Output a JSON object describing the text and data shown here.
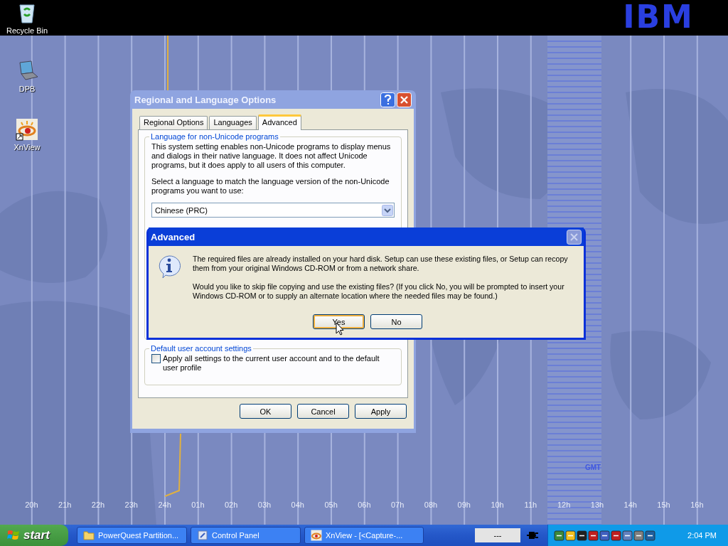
{
  "desktop": {
    "logo": "IBM",
    "icons": [
      {
        "label": "Recycle Bin",
        "kind": "recycle"
      },
      {
        "label": "DPB",
        "kind": "laptop"
      },
      {
        "label": "XnView",
        "kind": "viewer"
      }
    ],
    "map": {
      "hours": [
        "20h",
        "21h",
        "22h",
        "23h",
        "24h",
        "01h",
        "02h",
        "03h",
        "04h",
        "05h",
        "06h",
        "07h",
        "08h",
        "09h",
        "10h",
        "11h",
        "12h",
        "13h",
        "14h",
        "15h",
        "16h"
      ],
      "gmt_label": "GMT"
    }
  },
  "dialog": {
    "title": "Regional and Language Options",
    "tabs": [
      {
        "label": "Regional Options",
        "selected": false
      },
      {
        "label": "Languages",
        "selected": false
      },
      {
        "label": "Advanced",
        "selected": true
      }
    ],
    "language_group": {
      "title": "Language for non-Unicode programs",
      "description": "This system setting enables non-Unicode programs to display menus and dialogs in their native language. It does not affect Unicode programs, but it does apply to all users of this computer.",
      "prompt": "Select a language to match the language version of the non-Unicode programs you want to use:",
      "language": "Chinese (PRC)"
    },
    "account_group": {
      "title": "Default user account settings",
      "checkbox": {
        "label": "Apply all settings to the current user account and to the default user profile",
        "checked": false
      }
    },
    "buttons": [
      "OK",
      "Cancel",
      "Apply"
    ]
  },
  "message_box": {
    "title": "Advanced",
    "paragraphs": [
      "The required files are already installed on your hard disk. Setup can use these existing files, or Setup can recopy them from your original Windows CD-ROM or from a network share.",
      "Would you like to skip file copying and use the existing files? (If you click No, you will be prompted to insert your Windows CD-ROM or to supply an alternate location where the needed files may be found.)"
    ],
    "buttons": [
      {
        "label": "Yes",
        "default": true
      },
      {
        "label": "No",
        "default": false
      }
    ]
  },
  "taskbar": {
    "start": "start",
    "tasks": [
      {
        "label": "PowerQuest Partition...",
        "kind": "folder"
      },
      {
        "label": "Control Panel",
        "kind": "control"
      },
      {
        "label": "XnView - [<Capture-...",
        "kind": "viewer"
      }
    ],
    "indicator": "---",
    "clock": "2:04 PM"
  }
}
